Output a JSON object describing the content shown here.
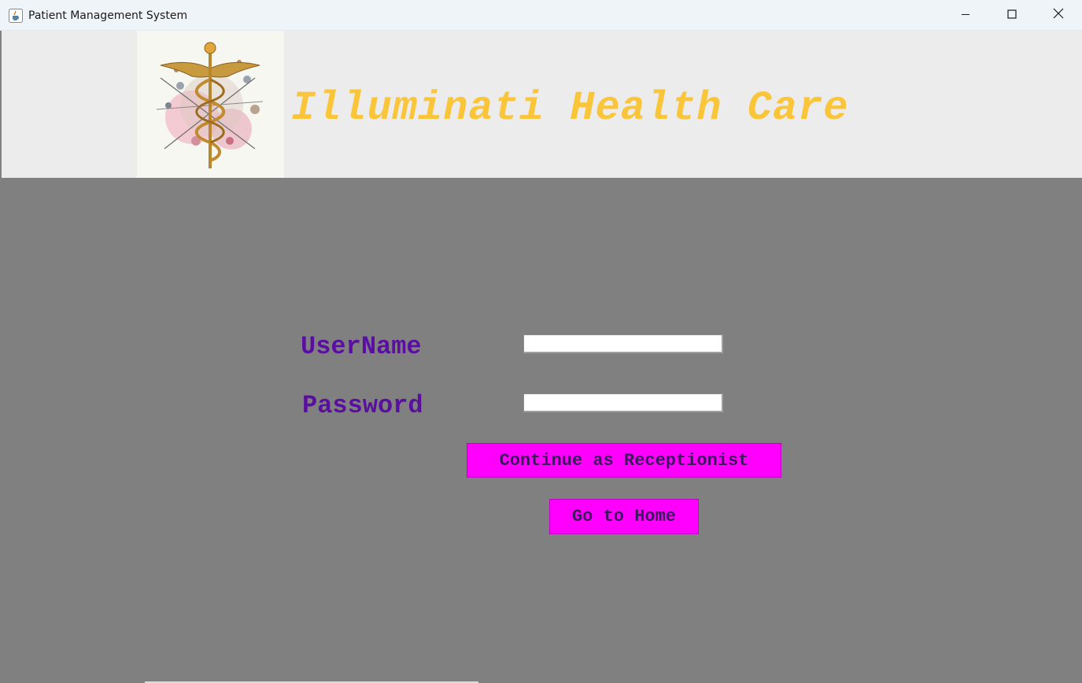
{
  "window": {
    "title": "Patient Management System",
    "icons": {
      "app": "java-cup-icon",
      "minimize": "minimize-icon",
      "maximize": "maximize-icon",
      "close": "close-icon"
    }
  },
  "header": {
    "brand_title": "Illuminati Health Care",
    "logo": "caduceus-logo",
    "brand_color": "#fbc53a"
  },
  "login": {
    "username_label": "UserName",
    "username_value": "",
    "password_label": "Password",
    "password_value": "",
    "label_color": "#5a0fa0"
  },
  "buttons": {
    "receptionist_label": "Continue as Receptionist",
    "home_label": "Go to Home",
    "button_color": "#ff00ff"
  }
}
